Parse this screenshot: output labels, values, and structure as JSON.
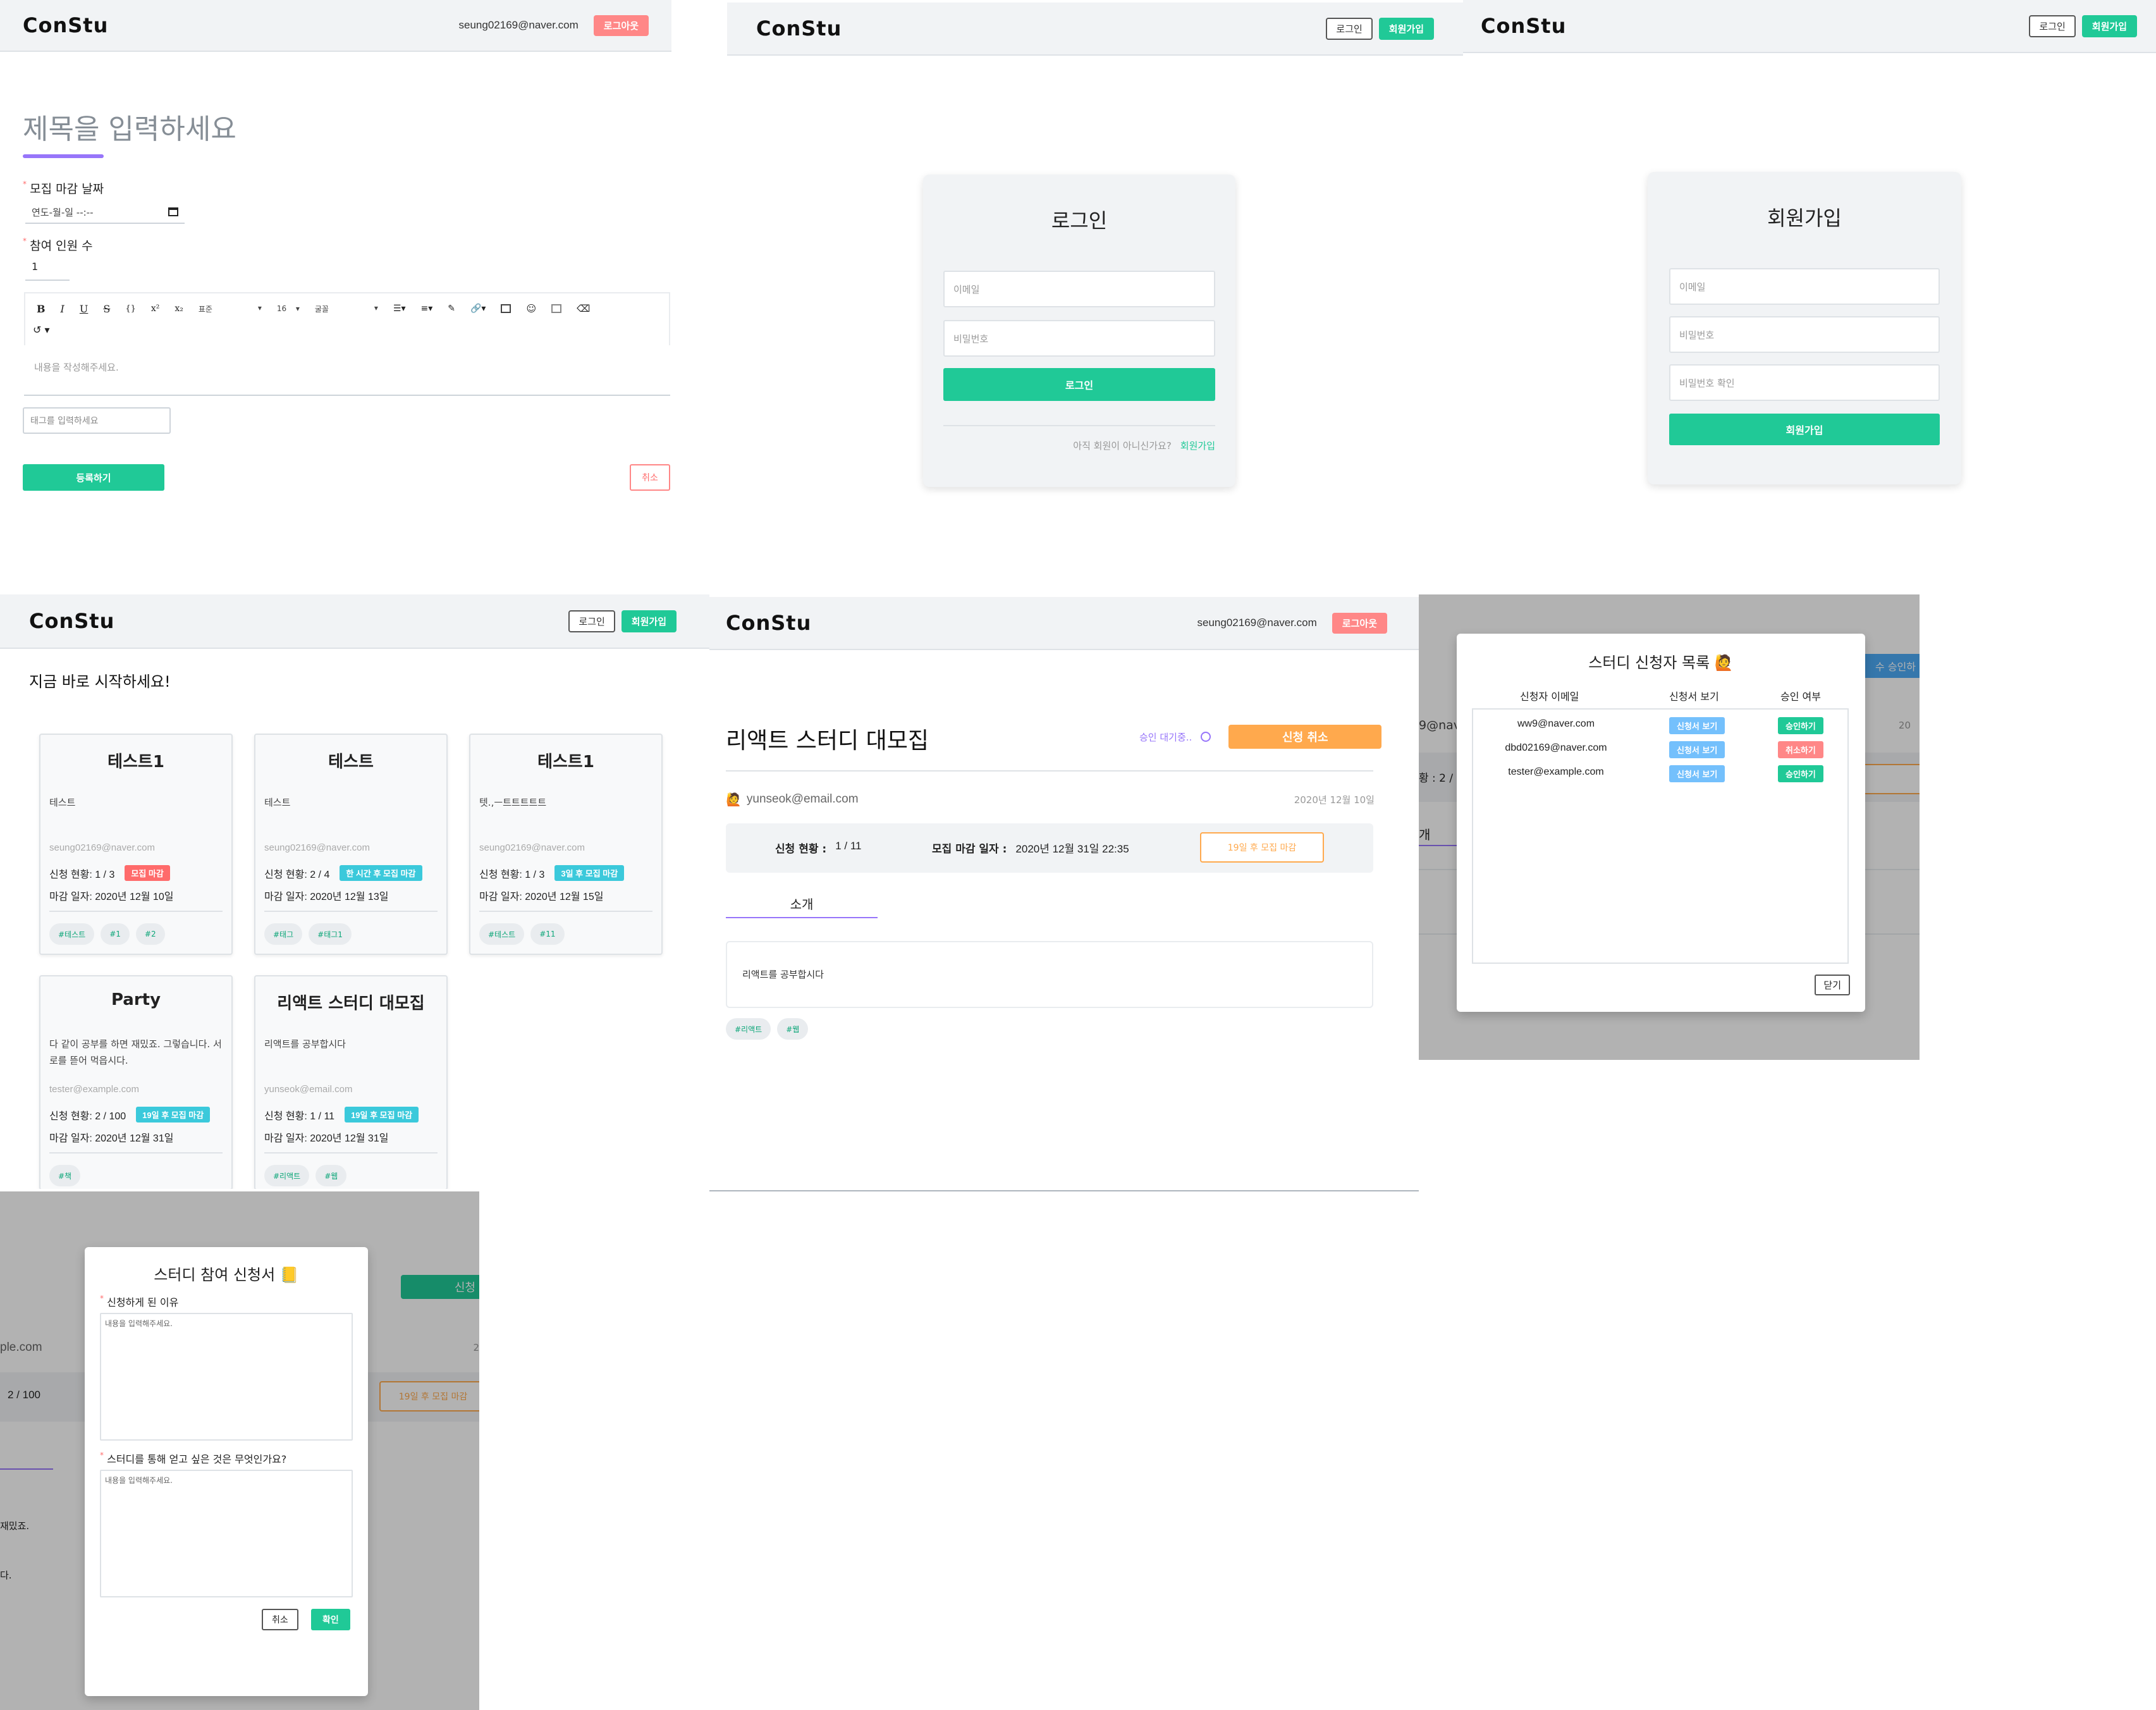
{
  "logo": "ConStu",
  "editor_page": {
    "user_email": "seung02169@naver.com",
    "logout_label": "로그아웃",
    "title_placeholder": "제목을 입력하세요",
    "deadline_label": "모집 마감 날짜",
    "deadline_placeholder": "연도-월-일 --:--",
    "participants_label": "참여 인원 수",
    "participants_value": "1",
    "toolbar": {
      "bold": "B",
      "italic": "I",
      "underline": "U",
      "strike": "S",
      "code": "{}",
      "superscript": "x²",
      "subscript": "x₂",
      "heading_select": "표준",
      "size_select": "16",
      "font_select": "굴꼴"
    },
    "content_placeholder": "내용을 작성해주세요.",
    "tag_placeholder": "태그를 입력하세요",
    "submit_label": "등록하기",
    "cancel_label": "취소"
  },
  "login_page": {
    "login_btn": "로그인",
    "signup_btn": "회원가입",
    "title": "로그인",
    "email_placeholder": "이메일",
    "password_placeholder": "비밀번호",
    "submit_label": "로그인",
    "footer_text": "아직 회원이 아니신가요?",
    "footer_link": "회원가입"
  },
  "signup_page": {
    "login_btn": "로그인",
    "signup_btn": "회원가입",
    "title": "회원가입",
    "email_placeholder": "이메일",
    "password_placeholder": "비밀번호",
    "password_confirm_placeholder": "비밀번호 확인",
    "submit_label": "회원가입"
  },
  "list_page": {
    "login_btn": "로그인",
    "signup_btn": "회원가입",
    "headline": "지금 바로 시작하세요!",
    "cards": [
      {
        "title": "테스트1",
        "desc": "테스트",
        "email": "seung02169@naver.com",
        "status": "신청 현황: 1 / 3",
        "badge": "모집 마감",
        "badge_color": "#ff6b6b",
        "deadline": "마감 일자: 2020년 12월 10일",
        "tags": [
          "#테스트",
          "#1",
          "#2"
        ]
      },
      {
        "title": "테스트",
        "desc": "테스트",
        "email": "seung02169@naver.com",
        "status": "신청 현황: 2 / 4",
        "badge": "한 시간 후 모집 마감",
        "badge_color": "#3bc9db",
        "deadline": "마감 일자: 2020년 12월 13일",
        "tags": [
          "#태그",
          "#태그1"
        ]
      },
      {
        "title": "테스트1",
        "desc": "텟.,ㅡ트트트트트",
        "email": "seung02169@naver.com",
        "status": "신청 현황: 1 / 3",
        "badge": "3일 후 모집 마감",
        "badge_color": "#3bc9db",
        "deadline": "마감 일자: 2020년 12월 15일",
        "tags": [
          "#테스트",
          "#11"
        ]
      },
      {
        "title": "Party",
        "desc": "다 같이 공부를 하면 재밌죠. 그렇습니다. 서로를 뜯어 먹읍시다.",
        "email": "tester@example.com",
        "status": "신청 현황: 2 / 100",
        "badge": "19일 후 모집 마감",
        "badge_color": "#3bc9db",
        "deadline": "마감 일자: 2020년 12월 31일",
        "tags": [
          "#책"
        ]
      },
      {
        "title": "리액트 스터디 대모집",
        "desc": "리액트를 공부합시다",
        "email": "yunseok@email.com",
        "status": "신청 현황: 1 / 11",
        "badge": "19일 후 모집 마감",
        "badge_color": "#3bc9db",
        "deadline": "마감 일자: 2020년 12월 31일",
        "tags": [
          "#리액트",
          "#웹"
        ]
      }
    ]
  },
  "detail_page": {
    "user_email": "seung02169@naver.com",
    "logout_label": "로그아웃",
    "title": "리액트 스터디 대모집",
    "approval_status": "승인 대기중..",
    "cancel_apply": "신청 취소",
    "author": "yunseok@email.com",
    "date": "2020년 12월 10일",
    "apply_status_label": "신청 현황 :",
    "apply_status_value": "1 / 11",
    "deadline_label": "모집 마감 일자 :",
    "deadline_value": "2020년 12월 31일 22:35",
    "badge": "19일 후 모집 마감",
    "intro_tab": "소개",
    "content": "리액트를 공부합시다",
    "tags": [
      "#리액트",
      "#웹"
    ]
  },
  "applicants_modal": {
    "title": "스터디 신청자 목록",
    "col_email": "신청자 이메일",
    "col_view": "신청서 보기",
    "col_approve": "승인 여부",
    "rows": [
      {
        "email": "ww9@naver.com",
        "view": "신청서 보기",
        "action": "승인하기",
        "action_color": "#20c997"
      },
      {
        "email": "dbd02169@naver.com",
        "view": "신청서 보기",
        "action": "취소하기",
        "action_color": "#ff8787"
      },
      {
        "email": "tester@example.com",
        "view": "신청서 보기",
        "action": "승인하기",
        "action_color": "#20c997"
      }
    ],
    "close_label": "닫기",
    "bg_text_1": "9@nav",
    "bg_text_2": "황 : 2 /",
    "bg_text_3": "개",
    "bg_text_4": "20",
    "bg_text_5": "1",
    "bg_btn": "수 승인하"
  },
  "application_modal": {
    "title": "스터디 참여 신청서",
    "q1": "신청하게 된 이유",
    "q1_placeholder": "내용을 입력해주세요.",
    "q2": "스터디를 통해 얻고 싶은 것은 무엇인가요?",
    "q2_placeholder": "내용을 입력해주세요.",
    "cancel_label": "취소",
    "confirm_label": "확인",
    "bg_email": "ple.com",
    "bg_status": "2 / 100",
    "bg_badge": "19일 후 모집 마감",
    "bg_btn": "신청",
    "bg_text_1": "재밌죠.",
    "bg_text_2": "다.",
    "bg_date": "2"
  }
}
